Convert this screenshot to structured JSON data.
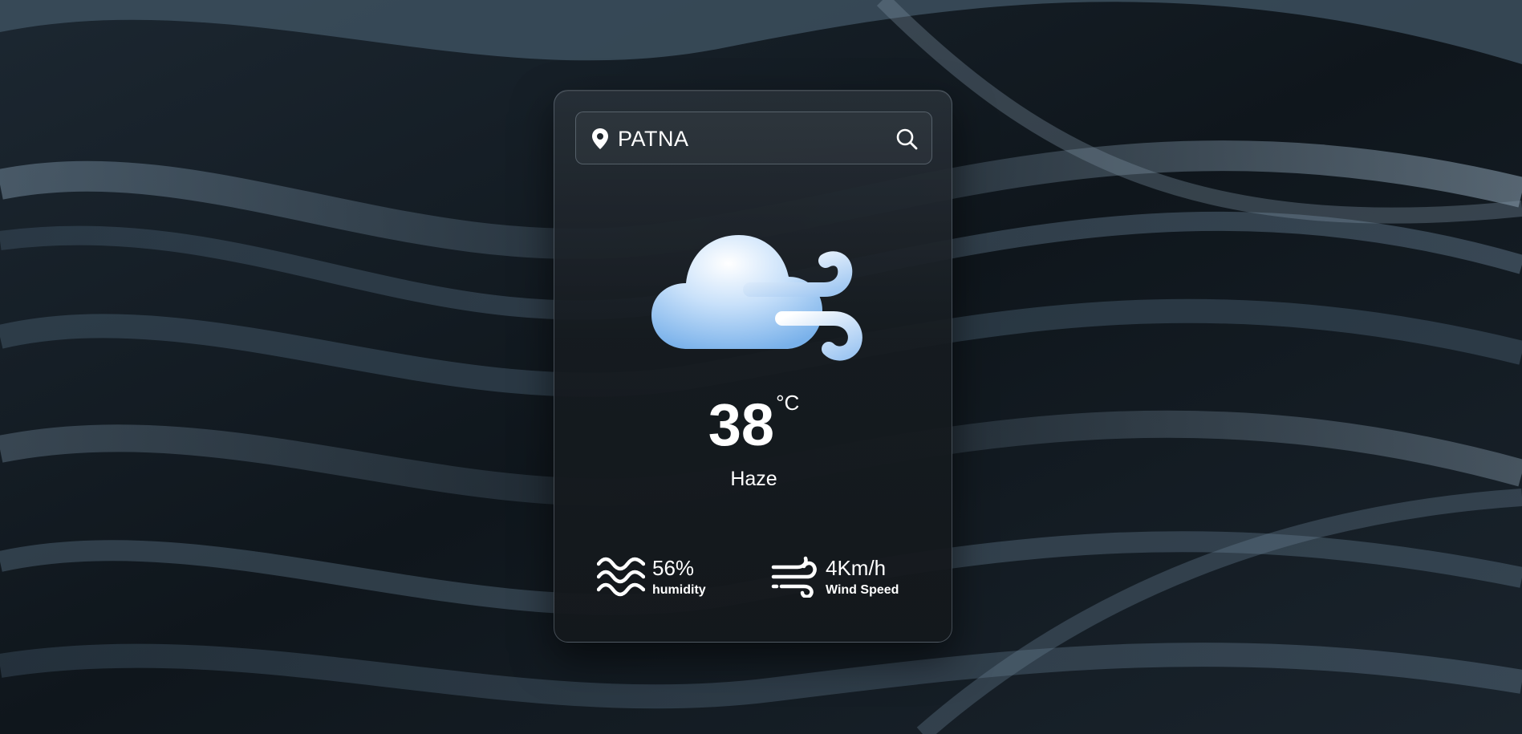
{
  "search": {
    "value": "PATNA",
    "pin_icon": "map-pin-icon",
    "search_icon": "search-icon"
  },
  "weather": {
    "icon": "cloud-wind-icon",
    "temperature": "38",
    "unit": "°C",
    "condition": "Haze"
  },
  "stats": {
    "humidity": {
      "icon": "waves-icon",
      "value": "56%",
      "label": "humidity"
    },
    "wind": {
      "icon": "wind-icon",
      "value": "4Km/h",
      "label": "Wind Speed"
    }
  },
  "colors": {
    "card_background": "#1b2127",
    "text": "#ffffff",
    "cloud": "#a9cdf5"
  }
}
